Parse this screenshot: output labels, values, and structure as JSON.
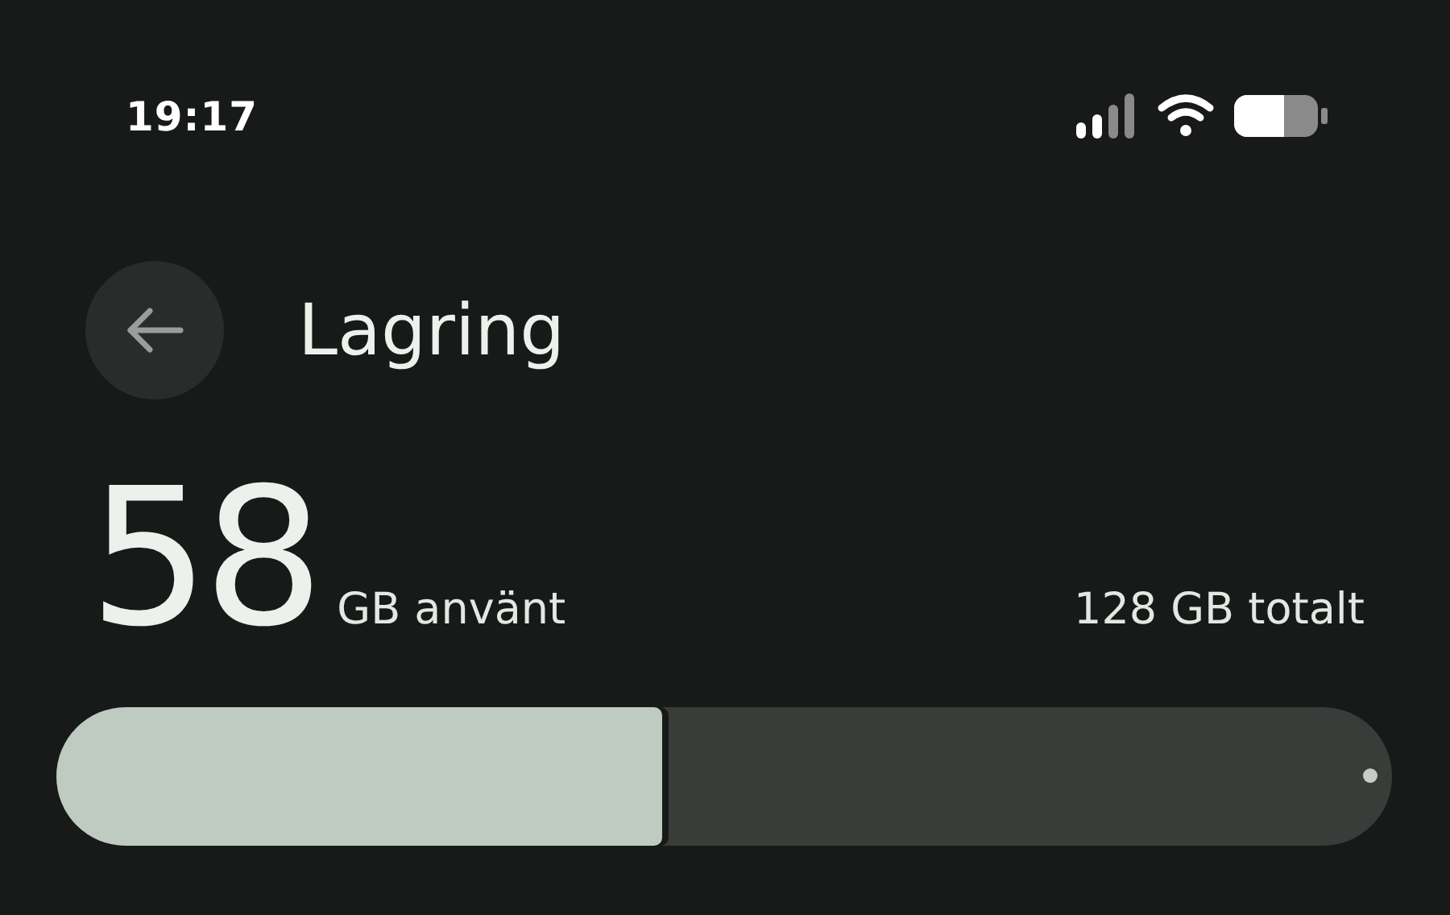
{
  "status_bar": {
    "time": "19:17"
  },
  "header": {
    "title": "Lagring"
  },
  "storage": {
    "used_value": "58",
    "used_label": "GB använt",
    "total": "128 GB totalt",
    "level": 0.453
  }
}
